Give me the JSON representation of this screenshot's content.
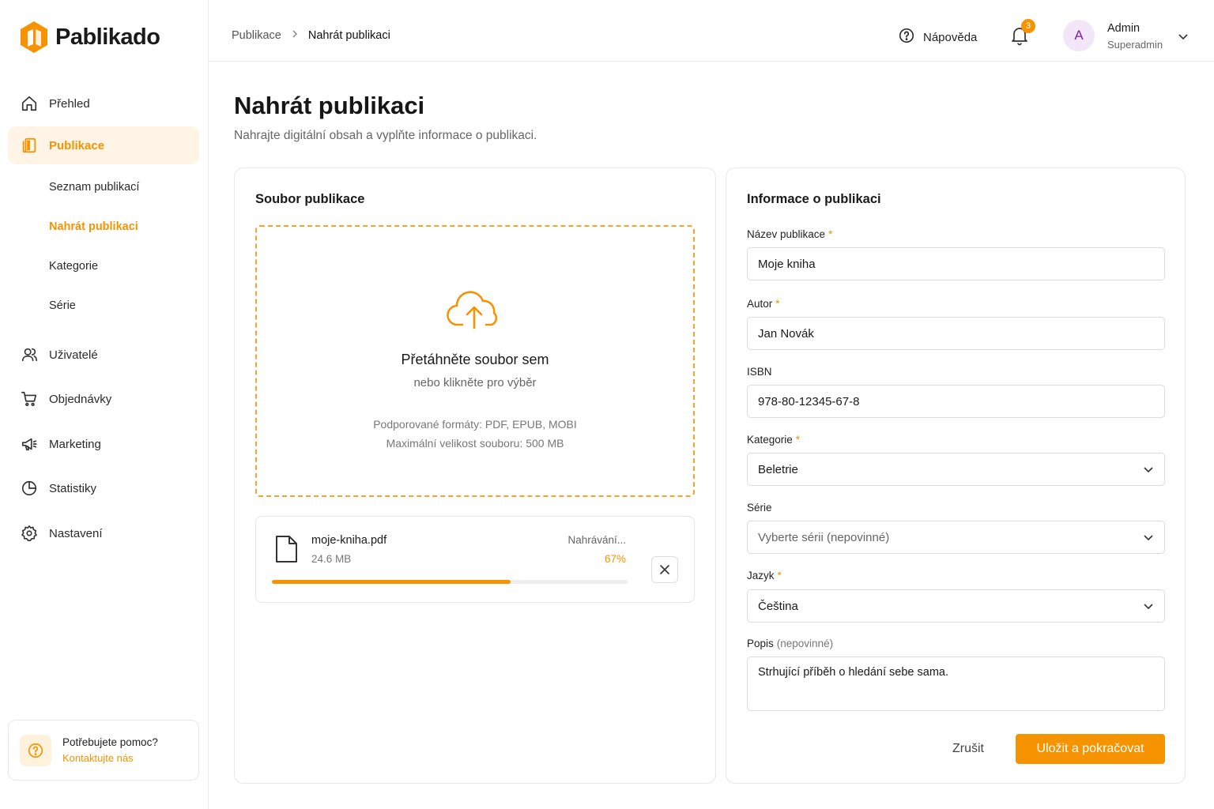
{
  "brand": {
    "name": "Pablikado",
    "accent": "#f59300"
  },
  "sidebar": {
    "items": [
      {
        "label": "Přehled",
        "icon": "home-icon"
      },
      {
        "label": "Publikace",
        "icon": "document-icon"
      },
      {
        "label": "Uživatelé",
        "icon": "users-icon"
      },
      {
        "label": "Objednávky",
        "icon": "cart-icon"
      },
      {
        "label": "Marketing",
        "icon": "megaphone-icon"
      },
      {
        "label": "Statistiky",
        "icon": "pie-chart-icon"
      },
      {
        "label": "Nastavení",
        "icon": "gear-icon"
      }
    ],
    "subitems": [
      {
        "label": "Seznam publikací"
      },
      {
        "label": "Nahrát publikaci"
      },
      {
        "label": "Kategorie"
      },
      {
        "label": "Série"
      }
    ],
    "help": {
      "title": "Potřebujete pomoc?",
      "link": "Kontaktujte nás"
    }
  },
  "header": {
    "breadcrumb": [
      "Publikace",
      "Nahrát publikaci"
    ],
    "help_label": "Nápověda",
    "notifications_count": "3",
    "user": {
      "initial": "A",
      "name": "Admin",
      "role": "Superadmin"
    }
  },
  "page": {
    "title": "Nahrát publikaci",
    "subtitle": "Nahrajte digitální obsah a vyplňte informace o publikaci."
  },
  "upload": {
    "card_title": "Soubor publikace",
    "drop_title": "Přetáhněte soubor sem",
    "drop_sub": "nebo klikněte pro výběr",
    "formats": "Podporované formáty: PDF, EPUB, MOBI",
    "max_size": "Maximální velikost souboru: 500 MB",
    "file": {
      "name": "moje-kniha.pdf",
      "size": "24.6 MB",
      "status": "Nahrávání...",
      "percent_label": "67%",
      "progress": 0.67
    }
  },
  "form": {
    "card_title": "Informace o publikaci",
    "title_label": "Název publikace",
    "title_value": "Moje kniha",
    "author_label": "Autor",
    "author_value": "Jan Novák",
    "isbn_label": "ISBN",
    "isbn_value": "978-80-12345-67-8",
    "category_label": "Kategorie",
    "category_value": "Beletrie",
    "series_label": "Série",
    "series_placeholder": "Vyberte sérii (nepovinné)",
    "language_label": "Jazyk",
    "language_value": "Čeština",
    "description_label": "Popis",
    "description_optional": "(nepovinné)",
    "description_value": "Strhující příběh o hledání sebe sama.",
    "required_mark": "*",
    "cancel_label": "Zrušit",
    "save_label": "Uložit a pokračovat"
  }
}
